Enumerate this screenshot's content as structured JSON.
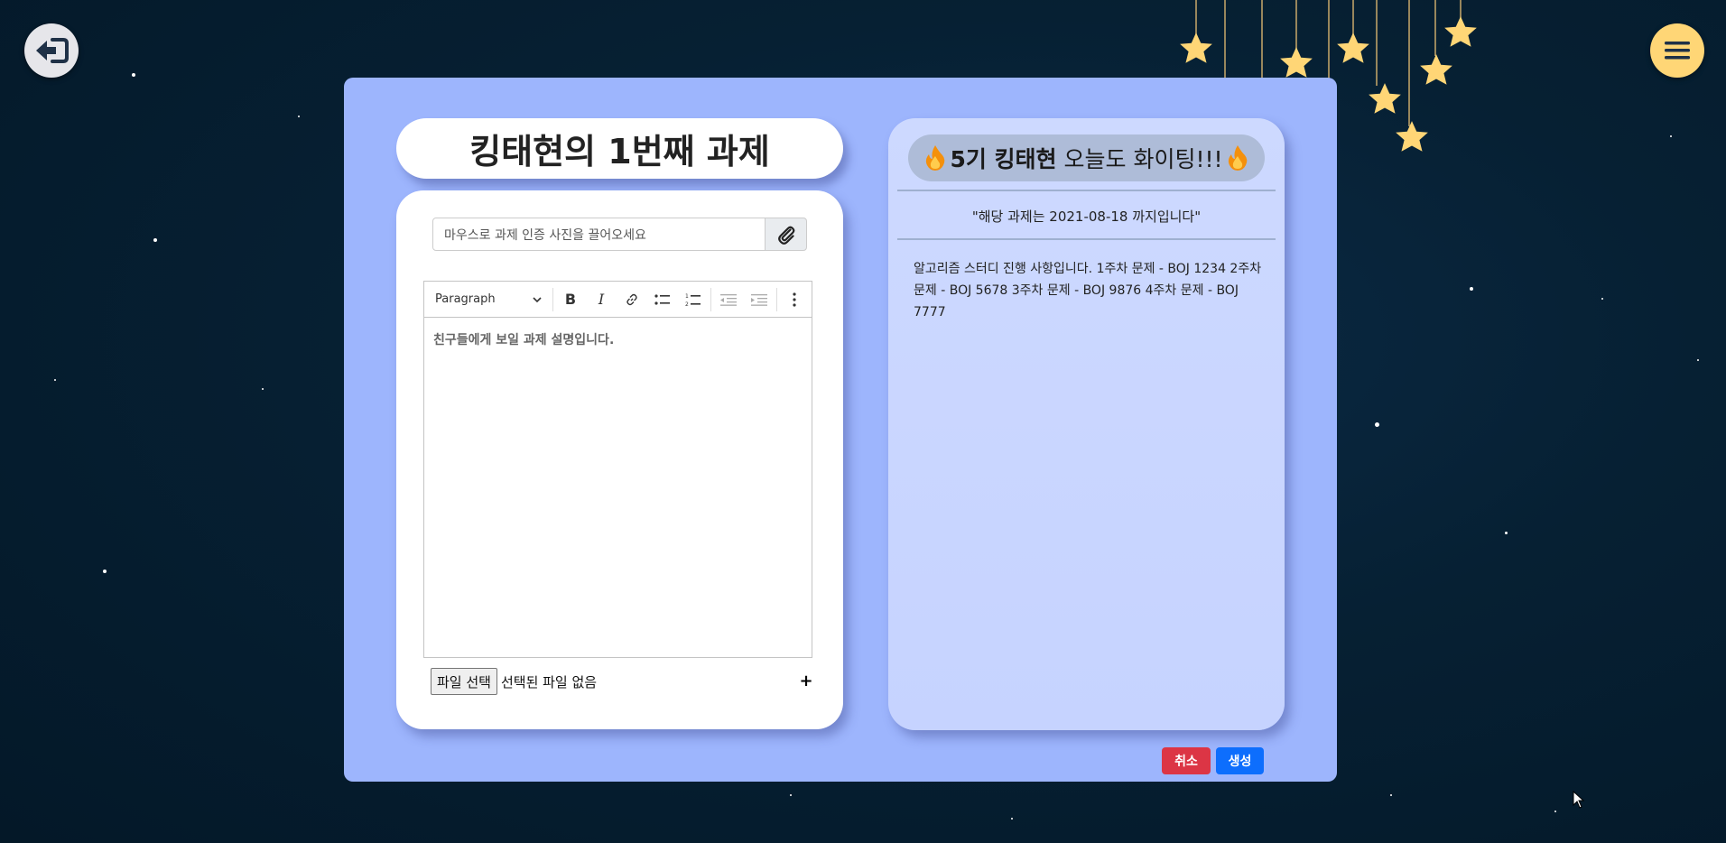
{
  "nav": {
    "back_icon": "sign-out-back-icon",
    "menu_icon": "hamburger-menu-icon"
  },
  "assignment": {
    "title": "킹태현의 1번째 과제",
    "drop_placeholder": "마우스로 과제 인증 사진을 끌어오세요",
    "attach_icon": "paperclip-icon"
  },
  "editor": {
    "block_format": "Paragraph",
    "toolbar_buttons": [
      "bold",
      "italic",
      "link",
      "bulleted-list",
      "numbered-list",
      "outdent",
      "indent",
      "more"
    ],
    "content": "친구들에게 보일 과제 설명입니다."
  },
  "file": {
    "choose_label": "파일 선택",
    "status": "선택된 파일 없음",
    "add_label": "+"
  },
  "info": {
    "cheer_prefix": "5기 킹태현",
    "cheer_suffix": " 오늘도 화이팅!!!",
    "deadline": "\"해당 과제는 2021-08-18 까지입니다\"",
    "description": "알고리즘 스터디 진행 사항입니다. 1주차 문제 - BOJ 1234 2주차 문제 - BOJ 5678 3주차 문제 - BOJ 9876 4주차 문제 - BOJ 7777"
  },
  "actions": {
    "cancel": "취소",
    "create": "생성"
  },
  "colors": {
    "panel": "#9db5fd",
    "star": "#ffd676",
    "cancel": "#dc3545",
    "create": "#0d6efd"
  }
}
